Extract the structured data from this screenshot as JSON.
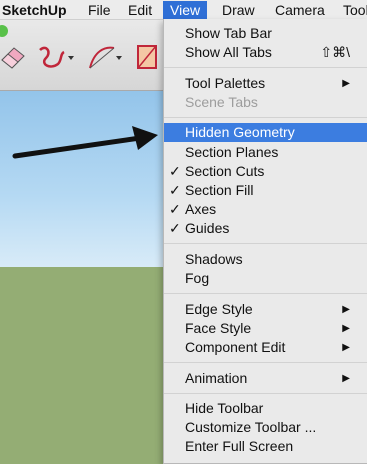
{
  "menubar": {
    "app": "SketchUp",
    "items": [
      "File",
      "Edit",
      "View",
      "Draw",
      "Camera",
      "Tools"
    ]
  },
  "colors": {
    "highlight": "#3c7de0",
    "menu_bg": "#eaeaea",
    "sky": "#a8d2f0",
    "ground": "#94ad74"
  },
  "toolbar": {
    "icons": [
      "eraser-icon",
      "freehand-icon",
      "arc-icon",
      "rectangle-icon"
    ]
  },
  "view_menu": {
    "show_tab_bar": "Show Tab Bar",
    "show_all_tabs": "Show All Tabs",
    "show_all_tabs_shortcut": "⇧⌘\\",
    "tool_palettes": "Tool Palettes",
    "scene_tabs": "Scene Tabs",
    "hidden_geometry": "Hidden Geometry",
    "section_planes": "Section Planes",
    "section_cuts": "Section Cuts",
    "section_fill": "Section Fill",
    "axes": "Axes",
    "guides": "Guides",
    "shadows": "Shadows",
    "fog": "Fog",
    "edge_style": "Edge Style",
    "face_style": "Face Style",
    "component_edit": "Component Edit",
    "animation": "Animation",
    "hide_toolbar": "Hide Toolbar",
    "customize_toolbar": "Customize Toolbar ...",
    "enter_full_screen": "Enter Full Screen",
    "check_mark": "✓",
    "submenu_arrow": "▶"
  }
}
